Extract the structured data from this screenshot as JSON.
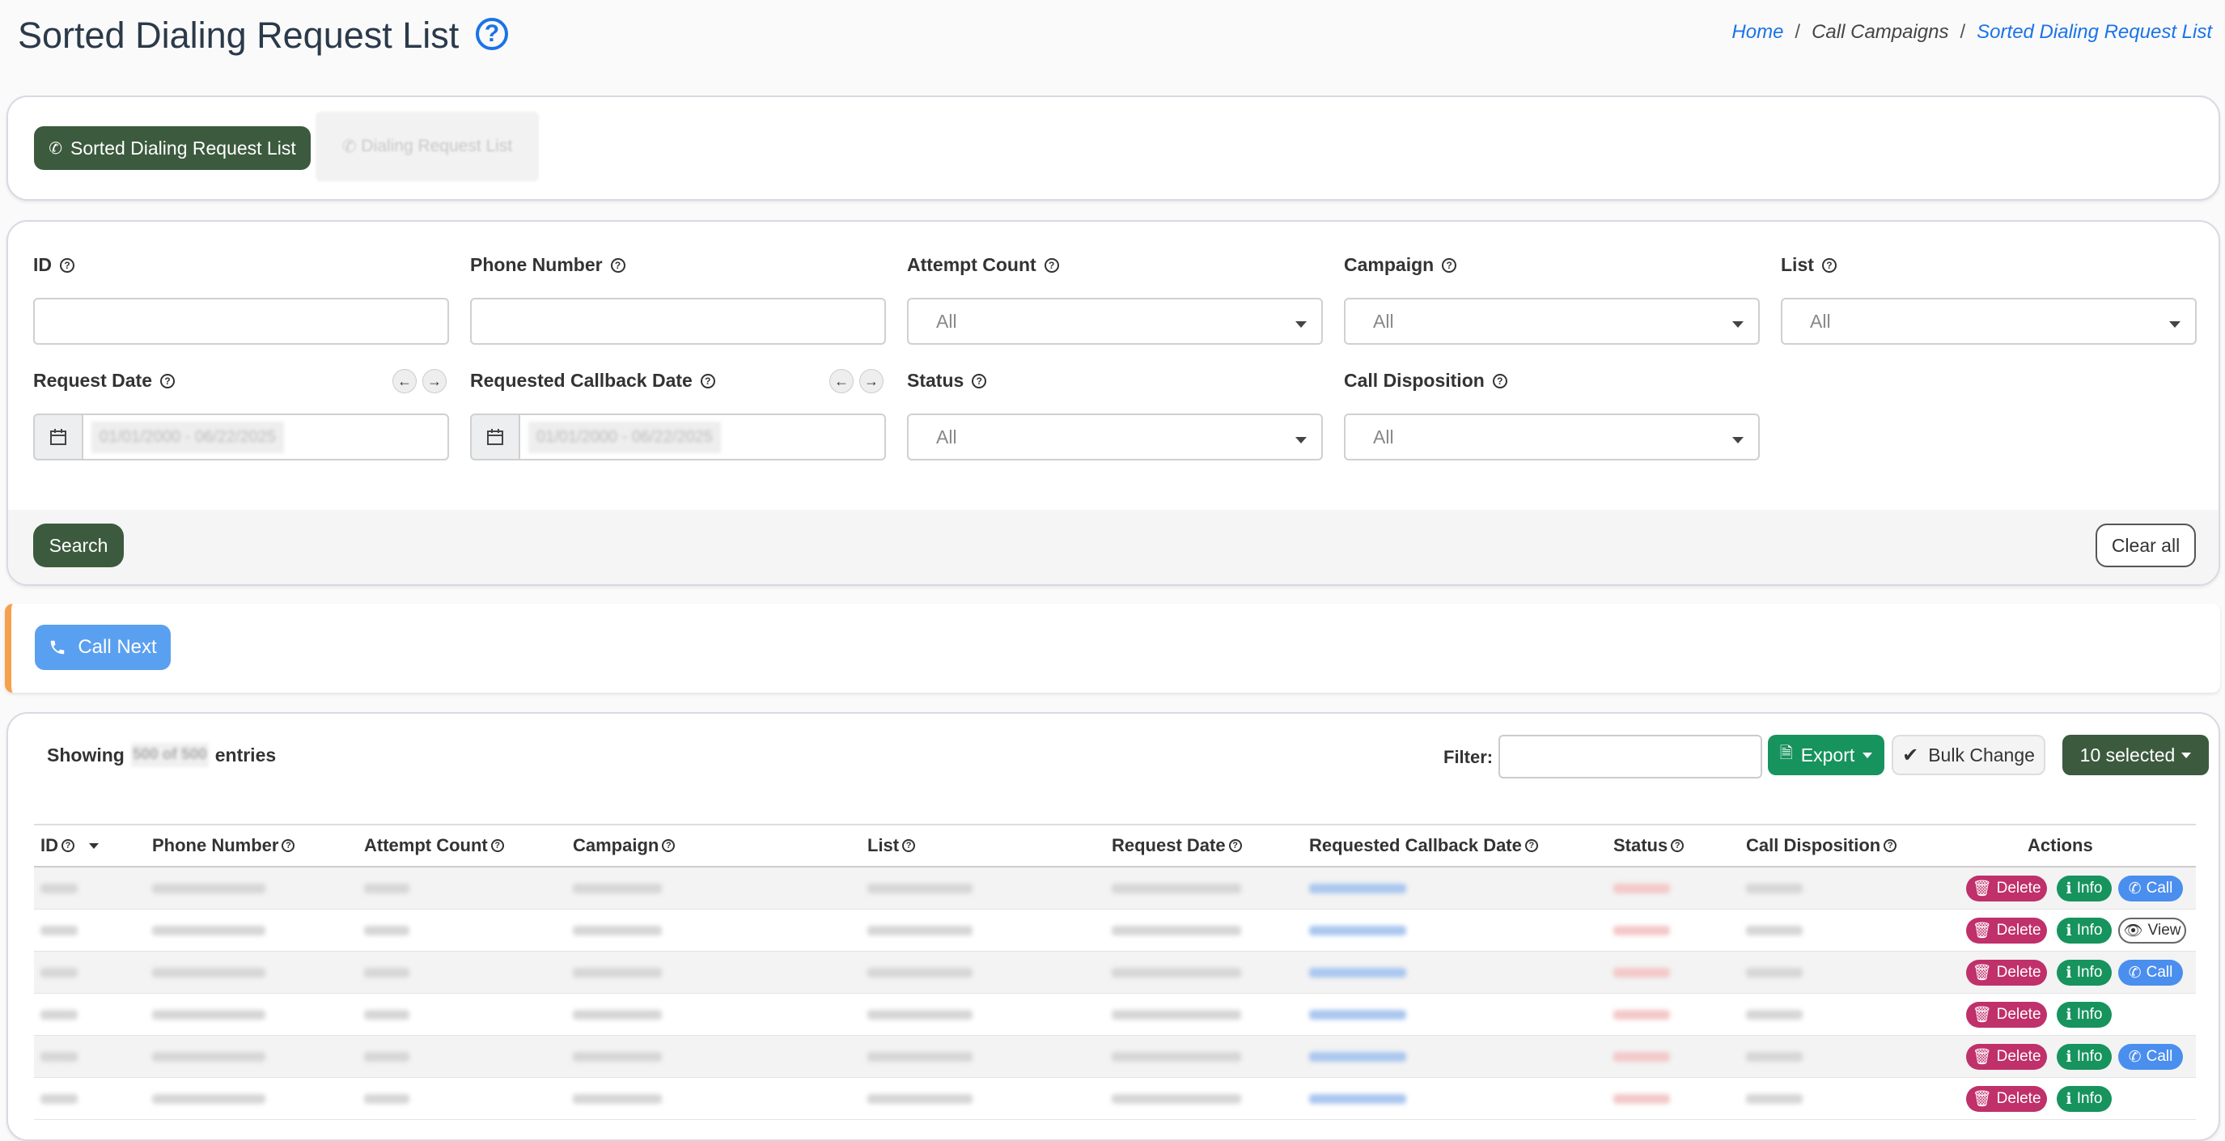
{
  "header": {
    "title": "Sorted Dialing Request List",
    "breadcrumb": {
      "home": "Home",
      "section": "Call Campaigns",
      "current": "Sorted Dialing Request List"
    }
  },
  "tabs": [
    {
      "label": "Sorted Dialing Request List",
      "active": true
    },
    {
      "label": "Dialing Request List",
      "active": false
    }
  ],
  "filters": {
    "id_label": "ID",
    "phone_label": "Phone Number",
    "attempt_label": "Attempt Count",
    "attempt_value": "All",
    "campaign_label": "Campaign",
    "campaign_value": "All",
    "list_label": "List",
    "list_value": "All",
    "request_date_label": "Request Date",
    "request_date_value": "01/01/2000 - 06/22/2025",
    "callback_date_label": "Requested Callback Date",
    "callback_date_value": "01/01/2000 - 06/22/2025",
    "status_label": "Status",
    "status_value": "All",
    "disposition_label": "Call Disposition",
    "disposition_value": "All",
    "search_button": "Search",
    "clear_button": "Clear all"
  },
  "call_next": {
    "label": "Call Next"
  },
  "table": {
    "showing_prefix": "Showing",
    "showing_count": "500 of 500",
    "showing_suffix": "entries",
    "filter_label": "Filter:",
    "export_label": "Export",
    "bulk_label": "Bulk Change",
    "selected_label": "10 selected",
    "columns": [
      "ID",
      "Phone Number",
      "Attempt Count",
      "Campaign",
      "List",
      "Request Date",
      "Requested Callback Date",
      "Status",
      "Call Disposition",
      "Actions"
    ],
    "actions": {
      "delete": "Delete",
      "info": "Info",
      "call": "Call",
      "view": "View"
    },
    "rows": [
      {
        "third": "call"
      },
      {
        "third": "view"
      },
      {
        "third": "call"
      },
      {
        "third": "none"
      },
      {
        "third": "call"
      },
      {
        "third": "none"
      }
    ]
  },
  "colors": {
    "primary_dark": "#3c5a3e",
    "link": "#1a73e8",
    "call_blue": "#5aa0f0",
    "delete": "#c0306a",
    "info": "#17935d",
    "accent_orange": "#f6a04d"
  }
}
